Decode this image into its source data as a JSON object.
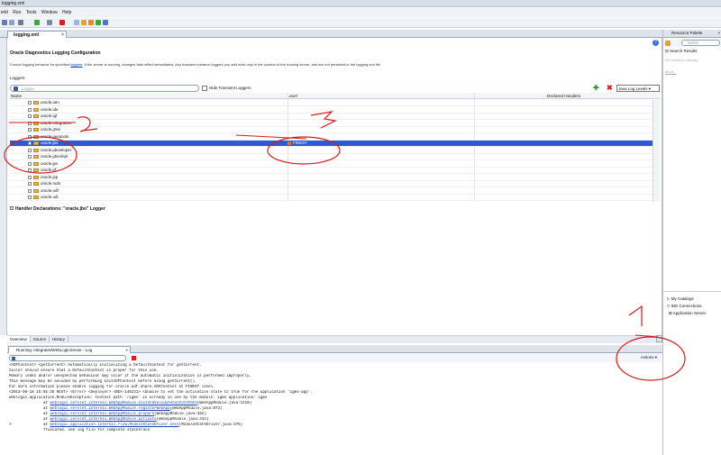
{
  "window": {
    "title": "logging.xml"
  },
  "menu": [
    {
      "label": "ield"
    },
    {
      "label": "Run"
    },
    {
      "label": "Tools"
    },
    {
      "label": "Window"
    },
    {
      "label": "Help"
    }
  ],
  "editor": {
    "tab_label": "logging.xml",
    "title": "Oracle Diagnostics Logging Configuration",
    "description_before": "Control logging behavior for specified ",
    "description_link": "loggers",
    "description_after": ". If the server is running, changes take effect immediately. Any transient instance loggers you add exist only in the context of the running server, and are not persisted to the logging.xml file.",
    "loggers_label": "Loggers:",
    "filter_placeholder": "Logger",
    "hide_transient_label": "Hide Transient Loggers",
    "level_select_value": "Java Log Levels",
    "columns": {
      "name": "Name",
      "level": "Level",
      "handlers": "Declared Handlers"
    },
    "rows": [
      {
        "name": "oracle.iam",
        "level": "",
        "selected": false
      },
      {
        "name": "oracle.ide",
        "level": "",
        "selected": false
      },
      {
        "name": "oracle.igf",
        "level": "",
        "selected": false
      },
      {
        "name": "oracle.integration",
        "level": "",
        "selected": false
      },
      {
        "name": "oracle.j2ee",
        "level": "",
        "selected": false
      },
      {
        "name": "oracle.javatools",
        "level": "",
        "selected": false
      },
      {
        "name": "oracle.jbo",
        "level": "FINEST",
        "selected": true
      },
      {
        "name": "oracle.jdeveloper",
        "level": "",
        "selected": false
      },
      {
        "name": "oracle.jdevimpl",
        "level": "",
        "selected": false
      },
      {
        "name": "oracle.jps",
        "level": "",
        "selected": false
      },
      {
        "name": "oracle.jrf",
        "level": "",
        "selected": false
      },
      {
        "name": "oracle.jsp",
        "level": "",
        "selected": false
      },
      {
        "name": "oracle.mds",
        "level": "",
        "selected": false
      },
      {
        "name": "oracle.odf",
        "level": "",
        "selected": false
      },
      {
        "name": "oracle.odi",
        "level": "",
        "selected": false
      }
    ],
    "handler_declarations": "Handler Declarations: \"oracle.jbo\" Logger"
  },
  "bottom_tabs": [
    {
      "label": "Overview"
    },
    {
      "label": "Source"
    },
    {
      "label": "History"
    }
  ],
  "log": {
    "tab_label": "Running: IntegratedWebLogicServer - Log",
    "actions_label": "Actions",
    "lines": [
      "<ADFContext> <getCurrent> Automatically initializing a DefaultContext for getCurrent.",
      "Caller should ensure that a DefaultContext is proper for this use.",
      "Memory leaks and/or unexpected behaviour may occur if the automatic initialization is performed improperly.",
      "This message may be avoided by performing initADFContext before using getCurrent().",
      "For more information please enable logging for oracle.adf.share.ADFContext at FINEST level.",
      "<2013-06-18 15:56:35 KEST> <Error> <Deployer> <BEA-149231> <Unable to set the activation state to true for the application 'igms-app'.",
      "weblogic.application.ModuleException: Context path '/igms' is already in use by the module: igms application: igms"
    ],
    "stack": [
      {
        "prefix": "at ",
        "link": "weblogic.servlet.internal.WebAppModule.initAndValidateContextPath",
        "suffix": "(WebAppModule.java:1210)"
      },
      {
        "prefix": "at ",
        "link": "weblogic.servlet.internal.WebAppModule.registerWebApp",
        "suffix": "(WebAppModule.java:873)"
      },
      {
        "prefix": "at ",
        "link": "weblogic.servlet.internal.WebAppModule.prepare",
        "suffix": "(WebAppModule.java:382)"
      },
      {
        "prefix": "at ",
        "link": "weblogic.servlet.internal.WebAppModule.activate",
        "suffix": "(WebAppModule.java:433)"
      },
      {
        "prefix": "at ",
        "link": "weblogic.application.internal.flow.ModuleStateDriver.next",
        "suffix": "(ModuleStateDriver.java:375)"
      },
      {
        "prefix": "Truncated. see log file for complete stacktrace",
        "link": "",
        "suffix": ""
      }
    ],
    "prompt": ">"
  },
  "right_panel": {
    "tab_label": "Resource Palette",
    "search_placeholder": "Name",
    "search_results": "Search Results",
    "no_results": "No results to display.",
    "more": "More...",
    "items": [
      {
        "label": "My Catalogs"
      },
      {
        "label": "IDE Connections"
      },
      {
        "label": "Application Server"
      }
    ]
  },
  "annotations": [
    {
      "label": "1"
    },
    {
      "label": "2"
    },
    {
      "label": "3"
    }
  ],
  "colors": {
    "selection": "#2a5bd7",
    "annotation": "#d61a1a",
    "level_icon": "#e2701c"
  }
}
